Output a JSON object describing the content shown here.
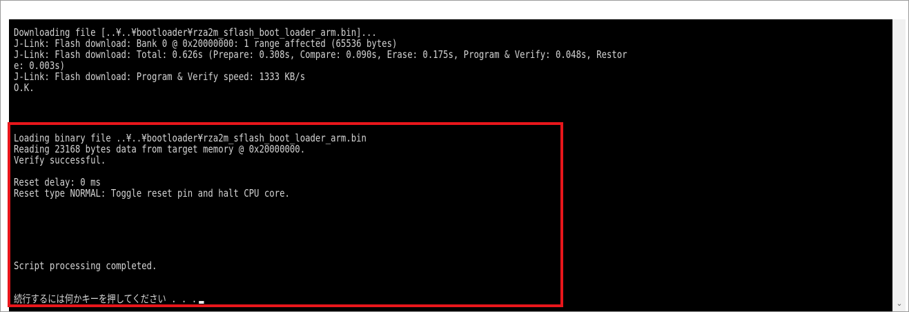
{
  "console": {
    "lines": [
      "Downloading file [..¥..¥bootloader¥rza2m_sflash_boot_loader_arm.bin]...",
      "J-Link: Flash download: Bank 0 @ 0x20000000: 1 range affected (65536 bytes)",
      "J-Link: Flash download: Total: 0.626s (Prepare: 0.308s, Compare: 0.090s, Erase: 0.175s, Program & Verify: 0.048s, Restor",
      "e: 0.003s)",
      "J-Link: Flash download: Program & Verify speed: 1333 KB/s",
      "O.K.",
      "",
      "Loading binary file ..¥..¥bootloader¥rza2m_sflash_boot_loader_arm.bin",
      "Reading 23168 bytes data from target memory @ 0x20000000.",
      "Verify successful.",
      "",
      "Reset delay: 0 ms",
      "Reset type NORMAL: Toggle reset pin and halt CPU core.",
      "",
      "",
      "",
      "Script processing completed.",
      "",
      "続行するには何かキーを押してください . . ."
    ]
  },
  "scrollbar": {
    "down_arrow": "⌄"
  },
  "colors": {
    "console_bg": "#000000",
    "console_text": "#d4d4d4",
    "highlight_border": "#e8161b"
  }
}
